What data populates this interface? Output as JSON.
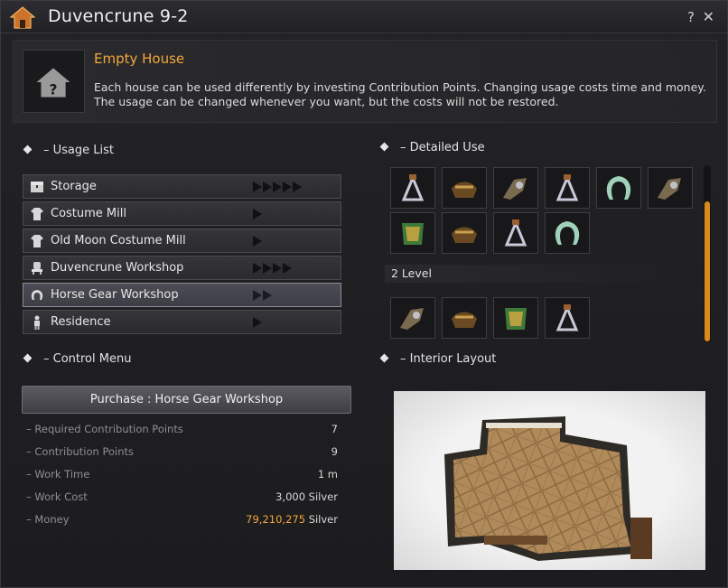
{
  "window": {
    "title": "Duvencrune 9-2",
    "help_label": "?",
    "close_label": "✕"
  },
  "house": {
    "name": "Empty House",
    "description": "Each house can be used differently by investing Contribution Points. Changing usage costs time and money. The usage can be changed whenever you want, but the costs will not be restored."
  },
  "usage_list": {
    "title": "– Usage List",
    "items": [
      {
        "label": "Storage",
        "icon": "chest-icon",
        "levels": 5
      },
      {
        "label": "Costume Mill",
        "icon": "shirt-icon",
        "levels": 1
      },
      {
        "label": "Old Moon Costume Mill",
        "icon": "shirt-icon",
        "levels": 1
      },
      {
        "label": "Duvencrune Workshop",
        "icon": "chair-icon",
        "levels": 4
      },
      {
        "label": "Horse Gear Workshop",
        "icon": "horseshoe-icon",
        "levels": 2,
        "selected": true
      },
      {
        "label": "Residence",
        "icon": "person-icon",
        "levels": 1
      }
    ]
  },
  "control_menu": {
    "title": "– Control Menu",
    "purchase_label": "Purchase : Horse Gear Workshop",
    "stats": [
      {
        "label": "– Required Contribution Points",
        "value": "7"
      },
      {
        "label": "– Contribution Points",
        "value": "9"
      },
      {
        "label": "– Work Time",
        "value": "1 m"
      },
      {
        "label": "– Work Cost",
        "value": "3,000 Silver"
      },
      {
        "label": "– Money",
        "value_highlight": "79,210,275",
        "value": "Silver"
      }
    ]
  },
  "detailed_use": {
    "title": "– Detailed Use",
    "level_label": "2 Level",
    "level1_items": [
      "stirrup-icon",
      "saddle-icon",
      "horse-armor-icon",
      "stirrup-icon",
      "horseshoe-icon",
      "horse-armor-icon",
      "barding-icon",
      "saddle-icon",
      "stirrup-icon",
      "horseshoe-icon"
    ],
    "level2_items": [
      "horse-armor-icon",
      "saddle-icon",
      "barding-icon",
      "stirrup-icon"
    ]
  },
  "interior_layout": {
    "title": "– Interior Layout"
  },
  "colors": {
    "accent": "#f2a73a",
    "scroll": "#d98a1c",
    "panel": "#1c1c1f"
  }
}
